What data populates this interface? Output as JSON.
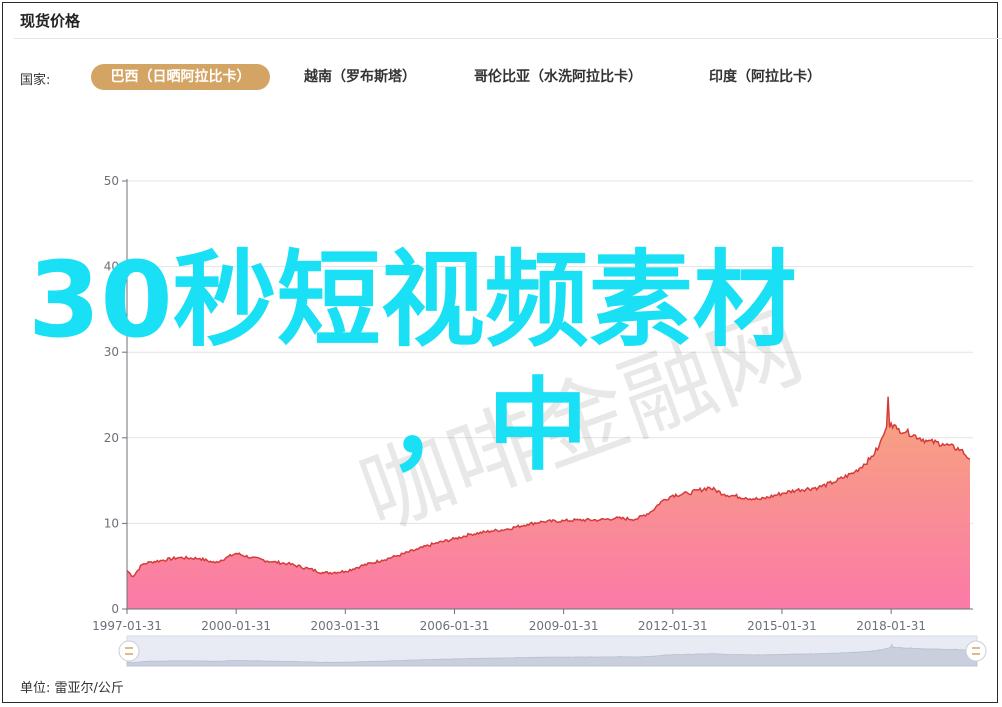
{
  "header": {
    "title": "现货价格"
  },
  "filter": {
    "label": "国家:",
    "tabs": [
      {
        "label": "巴西（日晒阿拉比卡）",
        "active": true
      },
      {
        "label": "越南（罗布斯塔）",
        "active": false
      },
      {
        "label": "哥伦比亚（水洗阿拉比卡）",
        "active": false
      },
      {
        "label": "印度（阿拉比卡）",
        "active": false
      }
    ]
  },
  "overlay": {
    "line1": "30秒短视频素材",
    "line2": "，中",
    "watermark": "咖啡金融网"
  },
  "footer": {
    "unit": "单位:  雷亚尔/公斤"
  },
  "colors": {
    "accent": "#d4a465",
    "line": "#d43c3c",
    "fill_top": "#f6a57c",
    "fill_bottom": "#fb7aa8",
    "title": "#19e0f5"
  },
  "slider": {
    "left_handle_icon": "slider-handle-icon",
    "right_handle_icon": "slider-handle-icon"
  },
  "chart_data": {
    "type": "area",
    "ylim": [
      0,
      50
    ],
    "yticks": [
      0,
      10,
      20,
      30,
      40,
      50
    ],
    "xticks": [
      "1997-01-31",
      "2000-01-31",
      "2003-01-31",
      "2006-01-31",
      "2009-01-31",
      "2012-01-31",
      "2015-01-31",
      "2018-01-31"
    ],
    "grid": true,
    "series": [
      {
        "x": [
          "1997-01",
          "1997-03",
          "1997-06",
          "1997-09",
          "1998-01",
          "1998-06",
          "1999-01",
          "1999-06",
          "2000-01",
          "2000-06",
          "2001-01",
          "2001-06",
          "2002-01",
          "2002-06",
          "2003-01",
          "2003-06",
          "2004-01",
          "2004-06",
          "2005-01",
          "2005-06",
          "2006-01",
          "2006-06",
          "2007-01",
          "2007-06",
          "2008-01",
          "2008-06",
          "2009-01",
          "2009-06",
          "2010-01",
          "2010-06",
          "2011-01",
          "2011-06",
          "2011-09",
          "2012-01",
          "2012-06",
          "2013-01",
          "2013-06",
          "2014-01",
          "2014-06",
          "2015-01",
          "2015-06",
          "2016-01",
          "2016-06",
          "2017-01",
          "2017-06",
          "2017-09",
          "2017-11",
          "2018-01",
          "2018-03",
          "2018-06",
          "2019-01",
          "2019-06",
          "2019-12",
          "2020-03"
        ],
        "y": [
          4.5,
          3.8,
          5.2,
          5.5,
          5.7,
          6.0,
          5.9,
          5.4,
          6.5,
          6.0,
          5.5,
          5.3,
          4.7,
          4.2,
          4.4,
          5.0,
          5.7,
          6.2,
          7.0,
          7.6,
          8.2,
          8.7,
          9.1,
          9.3,
          9.9,
          10.2,
          10.3,
          10.4,
          10.4,
          10.6,
          10.5,
          11.4,
          12.5,
          13.3,
          13.5,
          14.2,
          13.4,
          13.0,
          12.8,
          13.5,
          13.9,
          14.2,
          14.8,
          16.0,
          17.5,
          19.0,
          20.8,
          21.7,
          21.0,
          20.7,
          19.6,
          19.3,
          18.6,
          17.5
        ]
      }
    ]
  }
}
